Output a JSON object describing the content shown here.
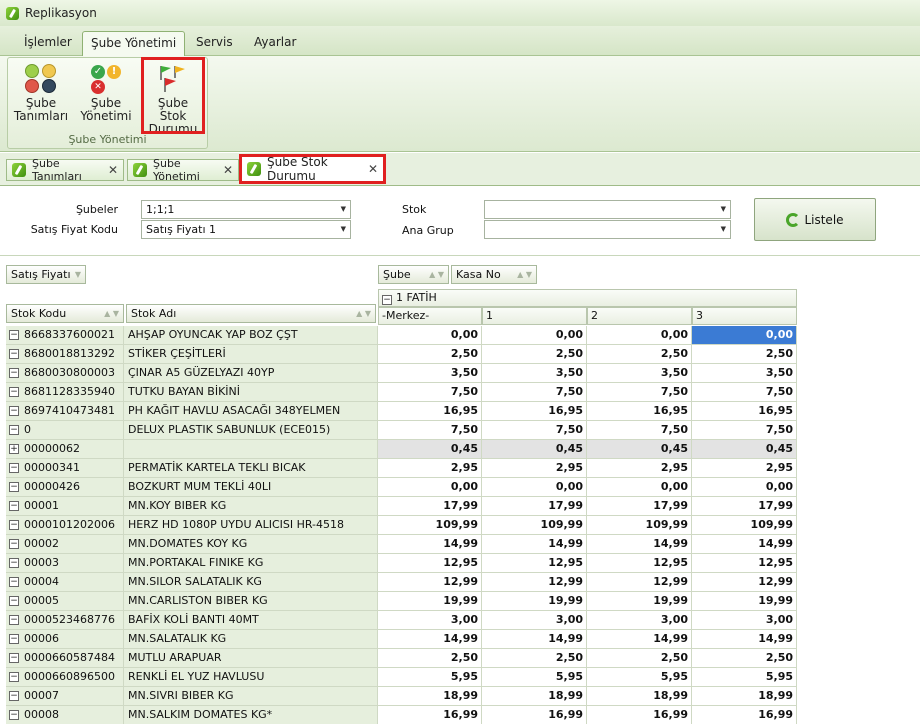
{
  "window": {
    "title": "Replikasyon"
  },
  "menu": {
    "tabs": [
      {
        "label": "İşlemler"
      },
      {
        "label": "Şube Yönetimi"
      },
      {
        "label": "Servis"
      },
      {
        "label": "Ayarlar"
      }
    ],
    "active_index": 1
  },
  "ribbon": {
    "group_caption": "Şube Yönetimi",
    "buttons": [
      {
        "line1": "Şube",
        "line2": "Tanımları",
        "icon": "colored-dots-icon"
      },
      {
        "line1": "Şube",
        "line2": "Yönetimi",
        "icon": "status-circles-icon"
      },
      {
        "line1": "Şube Stok",
        "line2": "Durumu",
        "icon": "flags-icon"
      }
    ]
  },
  "doc_tabs": [
    {
      "label": "Şube Tanımları"
    },
    {
      "label": "Şube Yönetimi"
    },
    {
      "label": "Şube Stok Durumu"
    }
  ],
  "filters": {
    "subeler": {
      "label": "Şubeler",
      "value": "1;1;1"
    },
    "satis_fiyat_kodu": {
      "label": "Satış Fiyat Kodu",
      "value": "Satış Fiyatı 1"
    },
    "stok": {
      "label": "Stok",
      "value": ""
    },
    "ana_grup": {
      "label": "Ana Grup",
      "value": ""
    },
    "listele_label": "Listele"
  },
  "grid": {
    "filter_field": "Satış Fiyatı",
    "column_fields": [
      "Şube",
      "Kasa No"
    ],
    "row_fields": [
      "Stok Kodu",
      "Stok Adı"
    ],
    "group_header": "1 FATİH",
    "value_columns": [
      "-Merkez-",
      "1",
      "2",
      "3"
    ],
    "rows": [
      {
        "code": "8668337600021",
        "name": "AHŞAP OYUNCAK YAP BOZ ÇŞT",
        "v": [
          "0,00",
          "0,00",
          "0,00",
          "0,00"
        ]
      },
      {
        "code": "8680018813292",
        "name": "STİKER ÇEŞİTLERİ",
        "v": [
          "2,50",
          "2,50",
          "2,50",
          "2,50"
        ]
      },
      {
        "code": "8680030800003",
        "name": "ÇINAR A5 GÜZELYAZI 40YP",
        "v": [
          "3,50",
          "3,50",
          "3,50",
          "3,50"
        ]
      },
      {
        "code": "8681128335940",
        "name": "TUTKU BAYAN BİKİNİ",
        "v": [
          "7,50",
          "7,50",
          "7,50",
          "7,50"
        ]
      },
      {
        "code": "8697410473481",
        "name": "PH KAĞIT HAVLU ASACAĞI 348YELMEN",
        "v": [
          "16,95",
          "16,95",
          "16,95",
          "16,95"
        ]
      },
      {
        "code": "0",
        "name": "DELUX PLASTIK SABUNLUK (ECE015)",
        "v": [
          "7,50",
          "7,50",
          "7,50",
          "7,50"
        ]
      },
      {
        "code": "00000062",
        "name": "",
        "v": [
          "0,45",
          "0,45",
          "0,45",
          "0,45"
        ]
      },
      {
        "code": "00000341",
        "name": "PERMATİK KARTELA  TEKLI BICAK",
        "v": [
          "2,95",
          "2,95",
          "2,95",
          "2,95"
        ]
      },
      {
        "code": "00000426",
        "name": "BOZKURT MUM TEKLİ 40LI",
        "v": [
          "0,00",
          "0,00",
          "0,00",
          "0,00"
        ]
      },
      {
        "code": "00001",
        "name": "MN.KOY BIBER KG",
        "v": [
          "17,99",
          "17,99",
          "17,99",
          "17,99"
        ]
      },
      {
        "code": "0000101202006",
        "name": "HERZ  HD 1080P UYDU ALICISI HR-4518",
        "v": [
          "109,99",
          "109,99",
          "109,99",
          "109,99"
        ]
      },
      {
        "code": "00002",
        "name": "MN.DOMATES KOY KG",
        "v": [
          "14,99",
          "14,99",
          "14,99",
          "14,99"
        ]
      },
      {
        "code": "00003",
        "name": "MN.PORTAKAL FINIKE KG",
        "v": [
          "12,95",
          "12,95",
          "12,95",
          "12,95"
        ]
      },
      {
        "code": "00004",
        "name": "MN.SILOR SALATALIK KG",
        "v": [
          "12,99",
          "12,99",
          "12,99",
          "12,99"
        ]
      },
      {
        "code": "00005",
        "name": "MN.CARLISTON BIBER KG",
        "v": [
          "19,99",
          "19,99",
          "19,99",
          "19,99"
        ]
      },
      {
        "code": "0000523468776",
        "name": "BAFİX KOLİ BANTI 40MT",
        "v": [
          "3,00",
          "3,00",
          "3,00",
          "3,00"
        ]
      },
      {
        "code": "00006",
        "name": "MN.SALATALIK KG",
        "v": [
          "14,99",
          "14,99",
          "14,99",
          "14,99"
        ]
      },
      {
        "code": "0000660587484",
        "name": "MUTLU ARAPUAR",
        "v": [
          "2,50",
          "2,50",
          "2,50",
          "2,50"
        ]
      },
      {
        "code": "0000660896500",
        "name": "RENKLİ EL YUZ HAVLUSU",
        "v": [
          "5,95",
          "5,95",
          "5,95",
          "5,95"
        ]
      },
      {
        "code": "00007",
        "name": "MN.SIVRI BIBER KG",
        "v": [
          "18,99",
          "18,99",
          "18,99",
          "18,99"
        ]
      },
      {
        "code": "00008",
        "name": "MN.SALKIM DOMATES KG*",
        "v": [
          "16,99",
          "16,99",
          "16,99",
          "16,99"
        ]
      }
    ]
  }
}
